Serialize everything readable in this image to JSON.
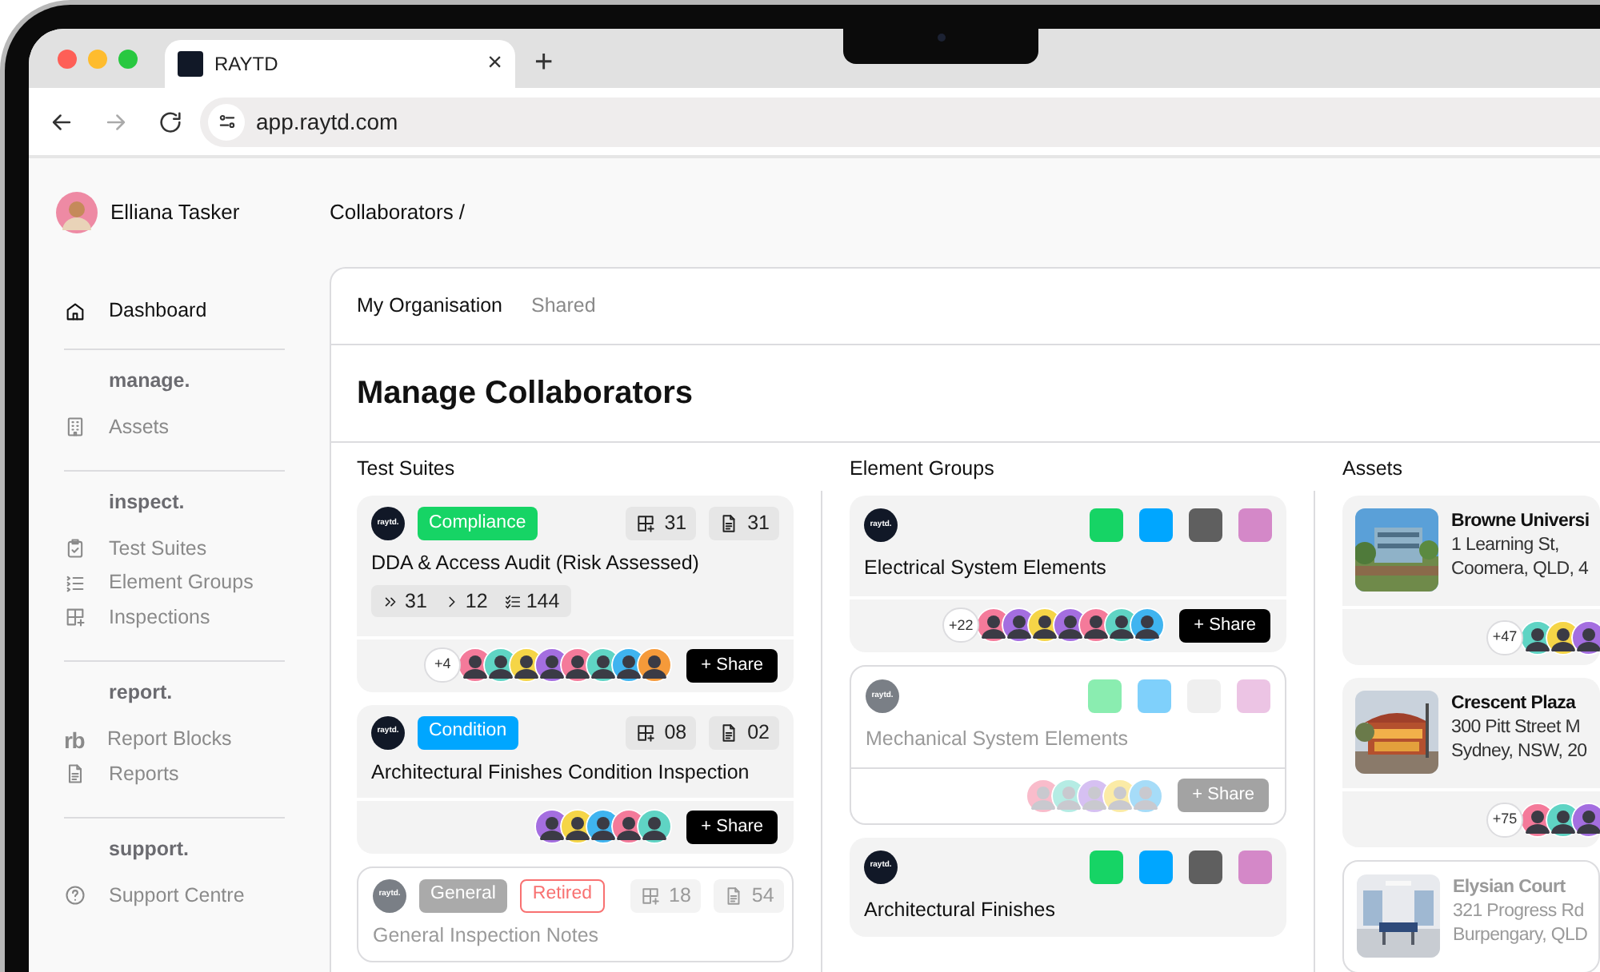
{
  "browser": {
    "tab_title": "RAYTD",
    "url": "app.raytd.com",
    "new_tab": "+",
    "close": "×"
  },
  "sidebar": {
    "user": {
      "name": "Elliana Tasker"
    },
    "top_items": [
      {
        "label": "Dashboard",
        "selected": true
      }
    ],
    "sections": [
      {
        "heading": "manage.",
        "items": [
          {
            "label": "Assets",
            "selected": false
          }
        ]
      },
      {
        "heading": "inspect.",
        "items": [
          {
            "label": "Test Suites",
            "selected": false
          },
          {
            "label": "Element Groups",
            "selected": false
          },
          {
            "label": "Inspections",
            "selected": false
          }
        ]
      },
      {
        "heading": "report.",
        "items": [
          {
            "label": "Report Blocks",
            "icon_text": "rb",
            "selected": false
          },
          {
            "label": "Reports",
            "selected": false
          }
        ]
      },
      {
        "heading": "support.",
        "items": [
          {
            "label": "Support Centre",
            "selected": false
          }
        ]
      }
    ]
  },
  "main": {
    "breadcrumb": "Collaborators /",
    "tabs": [
      {
        "label": "My Organisation",
        "selected": true
      },
      {
        "label": "Shared",
        "selected": false
      }
    ],
    "title": "Manage Collaborators",
    "columns": [
      {
        "heading": "Test Suites",
        "kind": "suite",
        "cards": [
          {
            "logo": "raytd.",
            "disabled": false,
            "tags": [
              {
                "label": "Compliance",
                "kind": "filled",
                "color": "#16d465"
              }
            ],
            "inspections": "31",
            "reports": "31",
            "title": "DDA & Access Audit (Risk Assessed)",
            "counts": [
              "31",
              "12",
              "144"
            ],
            "extra": "+4",
            "avatars": [
              {
                "color": "#f47a9a"
              },
              {
                "color": "#5fd4c4"
              },
              {
                "color": "#f5d547"
              },
              {
                "color": "#a46ee0"
              },
              {
                "color": "#f47a9a"
              },
              {
                "color": "#5fd4c4"
              },
              {
                "color": "#3fb4f0"
              },
              {
                "color": "#f59a3a"
              }
            ],
            "share": "+ Share"
          },
          {
            "logo": "raytd.",
            "disabled": false,
            "tags": [
              {
                "label": "Condition",
                "kind": "filled",
                "color": "#00a6ff"
              }
            ],
            "inspections": "08",
            "reports": "02",
            "title": "Architectural Finishes Condition Inspection",
            "avatars": [
              {
                "color": "#a46ee0"
              },
              {
                "color": "#f5d547"
              },
              {
                "color": "#3fb4f0"
              },
              {
                "color": "#f47a9a"
              },
              {
                "color": "#5fd4c4"
              }
            ],
            "share": "+ Share"
          },
          {
            "logo": "raytd.",
            "disabled": true,
            "tags": [
              {
                "label": "General",
                "kind": "filled",
                "color": "#aaaaaa"
              },
              {
                "label": "Retired",
                "kind": "outline",
                "color": "#f87171"
              }
            ],
            "inspections": "18",
            "reports": "54",
            "title": "General Inspection Notes"
          }
        ]
      },
      {
        "heading": "Element Groups",
        "kind": "group",
        "cards": [
          {
            "logo": "raytd.",
            "disabled": false,
            "swatches": [
              {
                "color": "#16d465"
              },
              {
                "color": "#00a6ff"
              },
              {
                "color": "#5f5f5f"
              },
              {
                "color": "#d488c8"
              }
            ],
            "title": "Electrical System Elements",
            "extra": "+22",
            "avatars": [
              {
                "color": "#f47a9a"
              },
              {
                "color": "#a46ee0"
              },
              {
                "color": "#f5d547"
              },
              {
                "color": "#a46ee0"
              },
              {
                "color": "#f47a9a"
              },
              {
                "color": "#5fd4c4"
              },
              {
                "color": "#3fb4f0"
              }
            ],
            "share": "+ Share"
          },
          {
            "logo": "raytd.",
            "disabled": true,
            "swatches": [
              {
                "color": "#8aedb0"
              },
              {
                "color": "#7fd0fb"
              },
              {
                "color": "#efefef"
              },
              {
                "color": "#ecc4e4"
              }
            ],
            "title": "Mechanical System Elements",
            "avatars": [
              {
                "color": "#f9bccb"
              },
              {
                "color": "#b5ece4"
              },
              {
                "color": "#d6c0f2"
              },
              {
                "color": "#fbeba6"
              },
              {
                "color": "#a6dcf8"
              }
            ],
            "share": "+ Share"
          },
          {
            "logo": "raytd.",
            "disabled": false,
            "swatches": [
              {
                "color": "#16d465"
              },
              {
                "color": "#00a6ff"
              },
              {
                "color": "#5f5f5f"
              },
              {
                "color": "#d488c8"
              }
            ],
            "title": "Architectural Finishes"
          }
        ]
      },
      {
        "heading": "Assets",
        "kind": "asset",
        "cards": [
          {
            "disabled": false,
            "title": "Browne Universi",
            "address": [
              "1 Learning St,",
              "Coomera, QLD, 4"
            ],
            "extra": "+47",
            "avatars": [
              {
                "color": "#5fd4c4"
              },
              {
                "color": "#f5d547"
              },
              {
                "color": "#a46ee0"
              }
            ]
          },
          {
            "disabled": false,
            "title": "Crescent Plaza",
            "address": [
              "300 Pitt Street M",
              "Sydney, NSW, 20"
            ],
            "extra": "+75",
            "avatars": [
              {
                "color": "#f47a9a"
              },
              {
                "color": "#5fd4c4"
              },
              {
                "color": "#a46ee0"
              }
            ]
          },
          {
            "disabled": true,
            "title": "Elysian Court",
            "address": [
              "321 Progress Rd",
              "Burpengary, QLD"
            ]
          }
        ]
      }
    ]
  }
}
